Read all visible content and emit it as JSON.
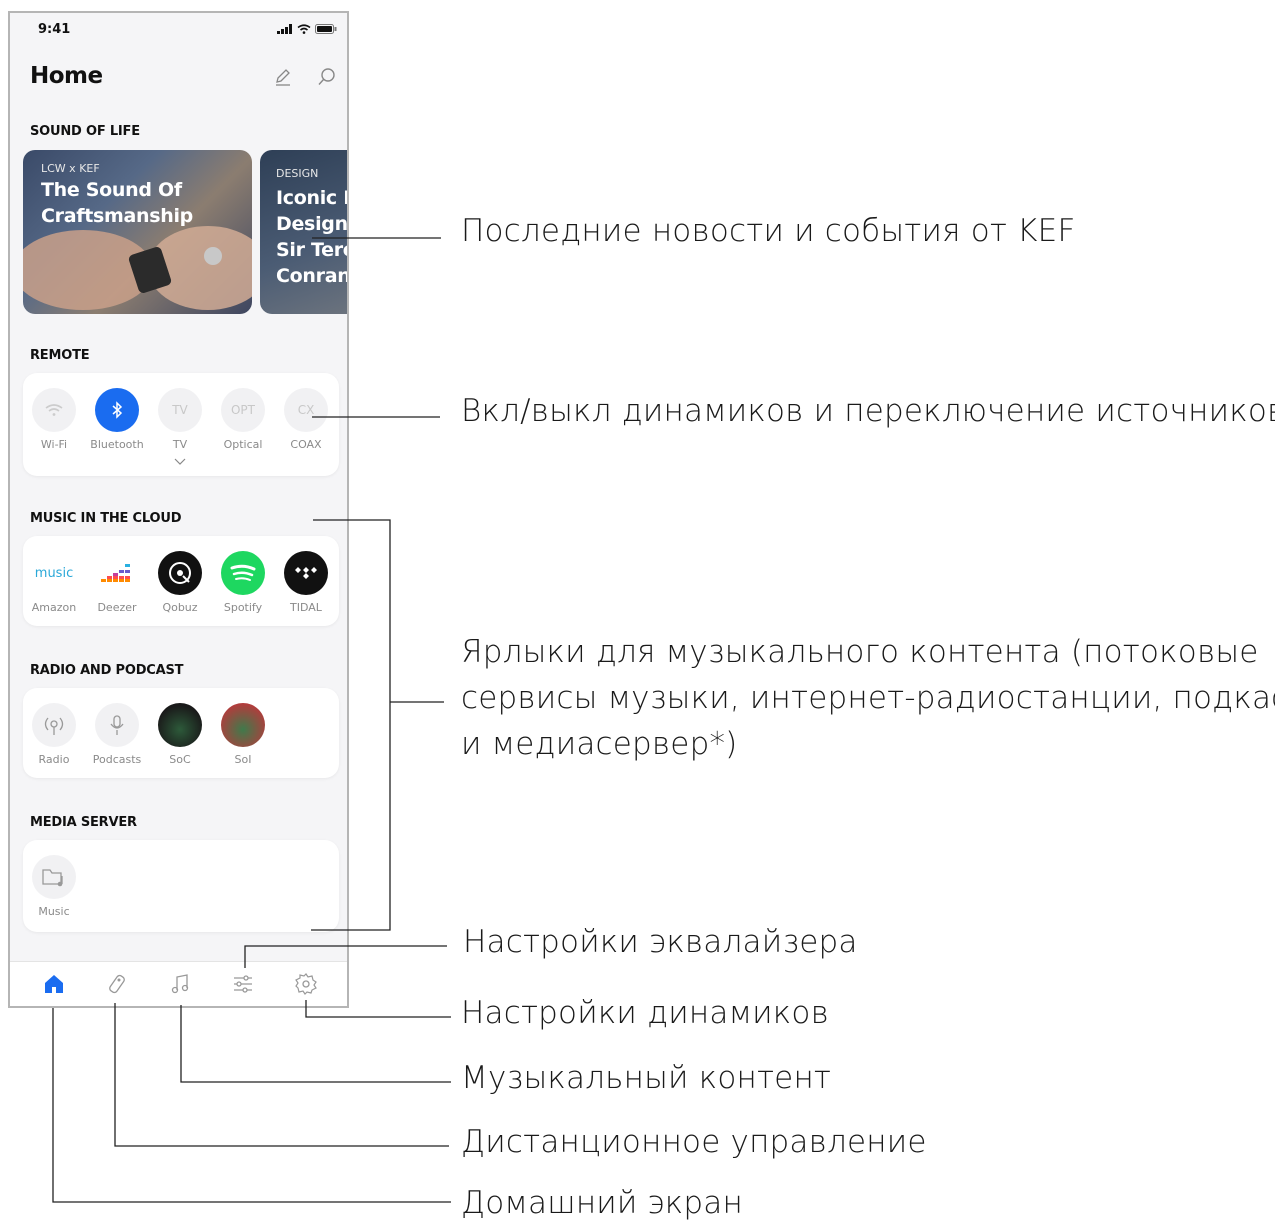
{
  "status_bar": {
    "time": "9:41"
  },
  "header": {
    "title": "Home"
  },
  "sections": {
    "sound_of_life": "SOUND OF LIFE",
    "remote": "REMOTE",
    "music_cloud": "MUSIC IN THE CLOUD",
    "radio_podcast": "RADIO AND PODCAST",
    "media_server": "MEDIA SERVER"
  },
  "news": [
    {
      "kicker": "LCW x KEF",
      "headline": "The Sound Of\nCraftsmanship"
    },
    {
      "kicker": "DESIGN",
      "headline": "Iconic E\nDesign\nSir Tere\nConran"
    }
  ],
  "remote_sources": [
    {
      "name": "Wi-Fi",
      "glyph": "wifi-icon"
    },
    {
      "name": "Bluetooth",
      "glyph": "bluetooth-icon"
    },
    {
      "name": "TV",
      "glyph": "TV"
    },
    {
      "name": "Optical",
      "glyph": "OPT"
    },
    {
      "name": "COAX",
      "glyph": "CX"
    }
  ],
  "cloud_services": [
    {
      "name": "Amazon",
      "logo": "music"
    },
    {
      "name": "Deezer"
    },
    {
      "name": "Qobuz"
    },
    {
      "name": "Spotify"
    },
    {
      "name": "TIDAL"
    }
  ],
  "radio_items": [
    {
      "name": "Radio"
    },
    {
      "name": "Podcasts"
    },
    {
      "name": "SoC"
    },
    {
      "name": "SoI"
    }
  ],
  "media_items": [
    {
      "name": "Music"
    }
  ],
  "tabs": [
    "home-icon",
    "remote-icon",
    "music-note-icon",
    "equalizer-icon",
    "gear-icon"
  ],
  "callouts": {
    "news": "Последние новости и события от KEF",
    "remote": "Вкл/выкл динамиков и переключение источников",
    "shortcuts_1": "Ярлыки для музыкального контента (потоковые",
    "shortcuts_2": "сервисы музыки, интернет-радиостанции, подкасты",
    "shortcuts_3": "и медиасервер*)",
    "eq": "Настройки эквалайзера",
    "speaker": "Настройки динамиков",
    "music": "Музыкальный контент",
    "remote_tab": "Дистанционное управление",
    "home": "Домашний экран"
  },
  "colors": {
    "accent": "#1a6cf0",
    "spotify": "#1ed760",
    "line": "#222222"
  }
}
